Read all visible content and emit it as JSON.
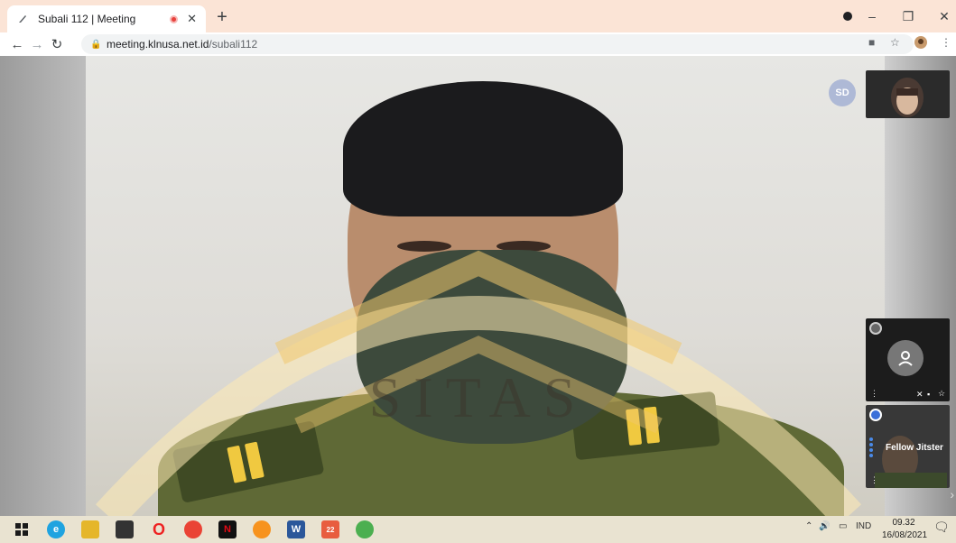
{
  "browser": {
    "tab_title": "Subali 112 | Meeting",
    "url_host": "meeting.klnusa.net.id",
    "url_path": "/subali112"
  },
  "meeting": {
    "participant_initials": "SD",
    "thumbnail_name": "Fellow Jitster",
    "watermark_text": "SITAS"
  },
  "taskbar": {
    "language": "IND",
    "time": "09.32",
    "date": "16/08/2021",
    "notification_badge": "22"
  },
  "colors": {
    "tab_strip": "#fbe4d6",
    "taskbar": "#e9e3d1",
    "record_dot": "#e8413c"
  }
}
